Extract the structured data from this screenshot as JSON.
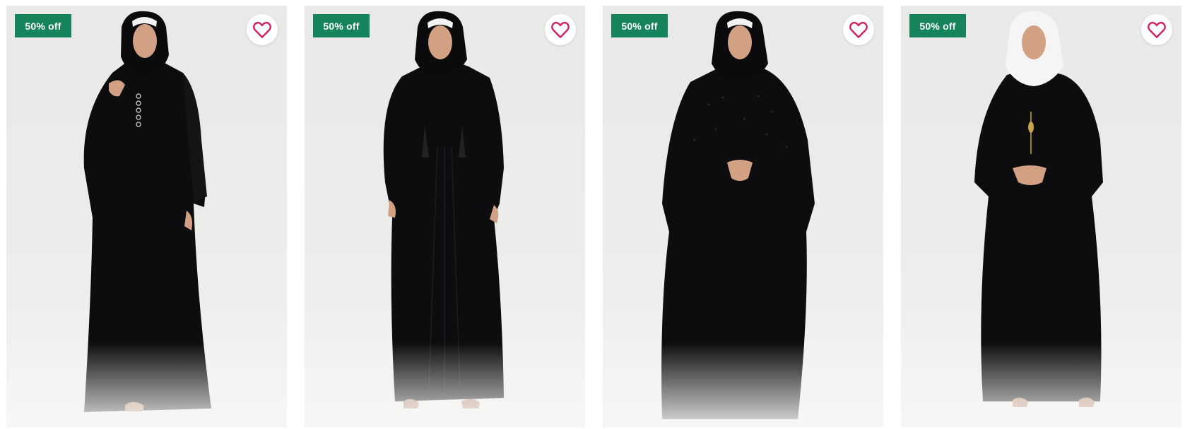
{
  "colors": {
    "badge_bg": "#16845a",
    "heart_stroke": "#d11f64",
    "garment": "#0d0d0f",
    "skin": "#d2a184",
    "inner_cap": "#f2f2f2"
  },
  "products": [
    {
      "badge": "50% off",
      "wishlist_icon": "heart-outline-icon",
      "hijab": "black",
      "style": "button-front"
    },
    {
      "badge": "50% off",
      "wishlist_icon": "heart-outline-icon",
      "hijab": "black",
      "style": "tassel-kaftan"
    },
    {
      "badge": "50% off",
      "wishlist_icon": "heart-outline-icon",
      "hijab": "black",
      "style": "embellished-butterfly"
    },
    {
      "badge": "50% off",
      "wishlist_icon": "heart-outline-icon",
      "hijab": "white",
      "style": "pendant-kaftan"
    }
  ]
}
